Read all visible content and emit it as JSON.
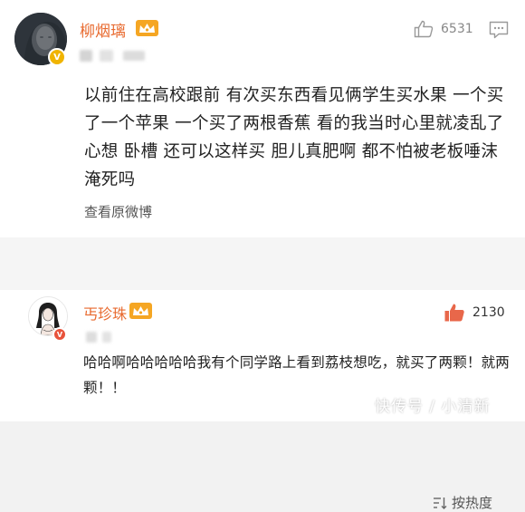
{
  "post": {
    "username": "柳烟璃",
    "like_count": "6531",
    "text": "以前住在高校跟前 有次买东西看见俩学生买水果 一个买了一个苹果 一个买了两根香蕉 看的我当时心里就凌乱了 心想 卧槽 还可以这样买 胆儿真肥啊 都不怕被老板唾沫淹死吗",
    "view_original": "查看原微博"
  },
  "sort": {
    "label": "按热度"
  },
  "reply": {
    "username": "丐珍珠",
    "like_count": "2130",
    "text": "哈哈啊哈哈哈哈哈我有个同学路上看到荔枝想吃，就买了两颗！就两颗！！"
  },
  "watermark": "快传号 / 小清新",
  "icons": {
    "post_verified": "verified-badge-icon",
    "reply_verified": "verified-badge-icon",
    "like": "thumbs-up-icon",
    "comment": "comment-icon",
    "sort": "sort-icon",
    "vip": "vip-crown-icon"
  },
  "colors": {
    "username": "#e86a2f",
    "vip_badge": "#f5a623",
    "verified_gold": "#f0b400",
    "verified_red": "#e8533b",
    "like_active": "#e8674a",
    "like_inactive": "#9a9a9a"
  }
}
